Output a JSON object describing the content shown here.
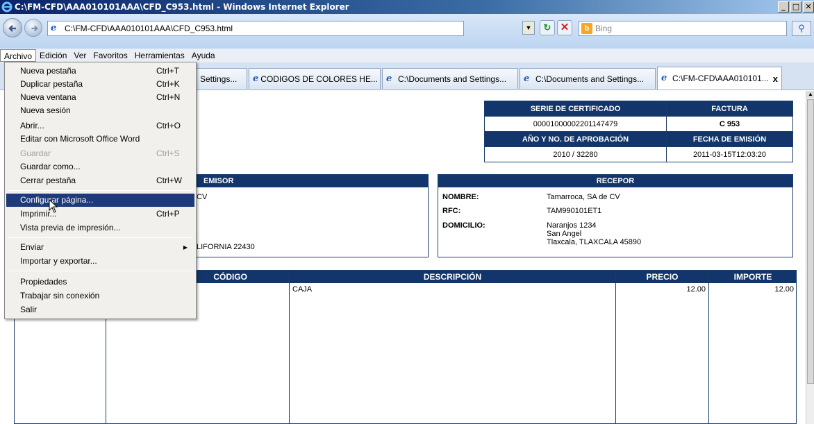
{
  "window": {
    "title": "C:\\FM-CFD\\AAA010101AAA\\CFD_C953.html - Windows Internet Explorer",
    "buttons": [
      "_",
      "□",
      "✕"
    ]
  },
  "address": {
    "url": "C:\\FM-CFD\\AAA010101AAA\\CFD_C953.html",
    "search_placeholder": "Bing",
    "search_provider_icon": "b"
  },
  "menubar": {
    "items": [
      "Archivo",
      "Edición",
      "Ver",
      "Favoritos",
      "Herramientas",
      "Ayuda"
    ]
  },
  "tabs": [
    {
      "label": "Settings..."
    },
    {
      "label": "CODIGOS DE COLORES HE..."
    },
    {
      "label": "C:\\Documents and Settings..."
    },
    {
      "label": "C:\\Documents and Settings..."
    },
    {
      "label": "C:\\FM-CFD\\AAA010101...",
      "close": "x"
    }
  ],
  "file_menu": {
    "items": [
      {
        "label": "Nueva pestaña",
        "shortcut": "Ctrl+T"
      },
      {
        "label": "Duplicar pestaña",
        "shortcut": "Ctrl+K"
      },
      {
        "label": "Nueva ventana",
        "shortcut": "Ctrl+N"
      },
      {
        "label": "Nueva sesión",
        "shortcut": ""
      },
      {
        "label": "Abrir...",
        "shortcut": "Ctrl+O"
      },
      {
        "label": "Editar con Microsoft Office Word",
        "shortcut": ""
      },
      {
        "label": "Guardar",
        "shortcut": "Ctrl+S",
        "disabled": true
      },
      {
        "label": "Guardar como...",
        "shortcut": ""
      },
      {
        "label": "Cerrar pestaña",
        "shortcut": "Ctrl+W"
      },
      {
        "label": "Configurar página...",
        "shortcut": "",
        "highlighted": true
      },
      {
        "label": "Imprimir...",
        "shortcut": "Ctrl+P"
      },
      {
        "label": "Vista previa de impresión...",
        "shortcut": ""
      },
      {
        "label": "Enviar",
        "shortcut": "",
        "submenu": true
      },
      {
        "label": "Importar y exportar...",
        "shortcut": ""
      },
      {
        "label": "Propiedades",
        "shortcut": ""
      },
      {
        "label": "Trabajar sin conexión",
        "shortcut": ""
      },
      {
        "label": "Salir",
        "shortcut": ""
      }
    ]
  },
  "certificate": {
    "serie_label": "SERIE DE CERTIFICADO",
    "serie_value": "00001000002201147479",
    "factura_label": "FACTURA",
    "factura_value": "C 953",
    "aprobacion_label": "AÑO Y NO. DE APROBACIÓN",
    "aprobacion_value": "2010 / 32280",
    "fecha_label": "FECHA DE EMISIÓN",
    "fecha_value": "2011-03-15T12:03:20"
  },
  "emisor": {
    "title": "EMISOR",
    "line1": "CV",
    "line2": "LIFORNIA 22430"
  },
  "receptor": {
    "title": "RECEPOR",
    "nombre_label": "NOMBRE:",
    "nombre_value": "Tamarroca, SA de CV",
    "rfc_label": "RFC:",
    "rfc_value": "TAM990101ET1",
    "domicilio_label": "DOMICILIO:",
    "domicilio_line1": "Naranjos 1234",
    "domicilio_line2": "San Angel",
    "domicilio_line3": "Tlaxcala, TLAXCALA 45890"
  },
  "items": {
    "headers": [
      "CÓDIGO",
      "DESCRIPCIÓN",
      "PRECIO",
      "IMPORTE"
    ],
    "rows": [
      {
        "codigo": "",
        "descripcion": "CAJA",
        "precio": "12.00",
        "importe": "12.00"
      }
    ]
  },
  "colors": {
    "header_blue": "#12356b",
    "menu_highlight": "#1e3a7a"
  }
}
